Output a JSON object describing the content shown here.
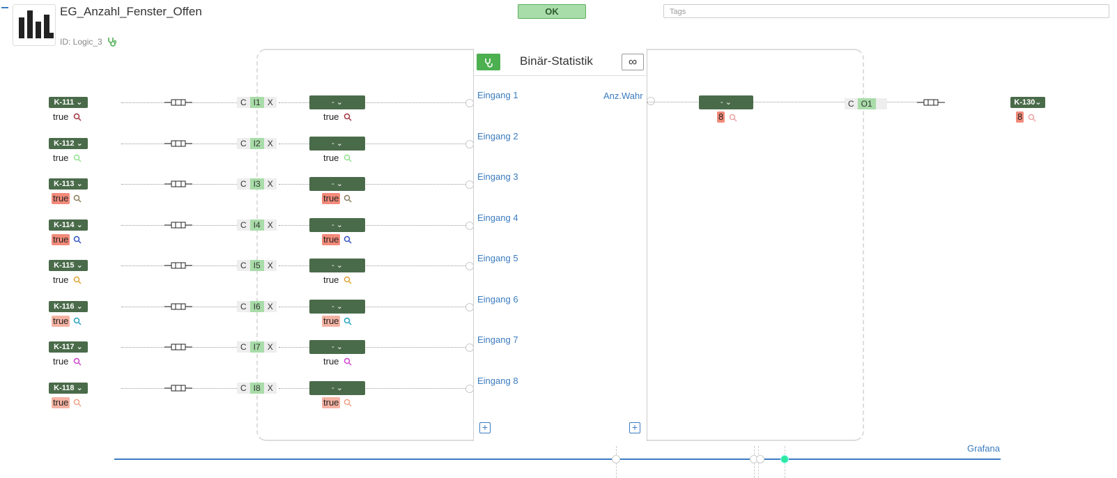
{
  "header": {
    "title": "EG_Anzahl_Fenster_Offen",
    "id_text": "ID: Logic_3",
    "ok_label": "OK",
    "tags_placeholder": "Tags"
  },
  "block": {
    "title": "Binär-Statistik",
    "inf_label": "∞",
    "output_label": "Anz.Wahr",
    "inputs": [
      "Eingang 1",
      "Eingang 2",
      "Eingang 3",
      "Eingang 4",
      "Eingang 5",
      "Eingang 6",
      "Eingang 7",
      "Eingang 8"
    ]
  },
  "rows": [
    {
      "tag": "K-111",
      "value": "true",
      "hl": "",
      "mag_color": "#a0303a",
      "port": "I1",
      "dash": "-",
      "val2": "true",
      "hl2": "",
      "mag2": "#a0303a"
    },
    {
      "tag": "K-112",
      "value": "true",
      "hl": "",
      "mag_color": "#8ee08e",
      "port": "I2",
      "dash": "-",
      "val2": "true",
      "hl2": "",
      "mag2": "#8ee08e"
    },
    {
      "tag": "K-113",
      "value": "true",
      "hl": "hl",
      "mag_color": "#8a7a5a",
      "port": "I3",
      "dash": "-",
      "val2": "true",
      "hl2": "hl",
      "mag2": "#8a7a5a"
    },
    {
      "tag": "K-114",
      "value": "true",
      "hl": "hl",
      "mag_color": "#3050c0",
      "port": "I4",
      "dash": "-",
      "val2": "true",
      "hl2": "hl",
      "mag2": "#3050c0"
    },
    {
      "tag": "K-115",
      "value": "true",
      "hl": "",
      "mag_color": "#e0a030",
      "port": "I5",
      "dash": "-",
      "val2": "true",
      "hl2": "",
      "mag2": "#e0a030"
    },
    {
      "tag": "K-116",
      "value": "true",
      "hl": "hl2",
      "mag_color": "#20a0c0",
      "port": "I6",
      "dash": "-",
      "val2": "true",
      "hl2": "hl2",
      "mag2": "#20a0c0"
    },
    {
      "tag": "K-117",
      "value": "true",
      "hl": "",
      "mag_color": "#d040d0",
      "port": "I7",
      "dash": "-",
      "val2": "true",
      "hl2": "",
      "mag2": "#d040d0"
    },
    {
      "tag": "K-118",
      "value": "true",
      "hl": "hl2",
      "mag_color": "#f0a080",
      "port": "I8",
      "dash": "-",
      "val2": "true",
      "hl2": "hl2",
      "mag2": "#f0a080"
    }
  ],
  "output": {
    "dash": "-",
    "value": "8",
    "port_c": "C",
    "port": "O1",
    "tag": "K-130",
    "tag_value": "8",
    "mag_color": "#f0a0a0"
  },
  "footer": {
    "grafana": "Grafana"
  },
  "labels": {
    "c": "C",
    "x": "X"
  }
}
